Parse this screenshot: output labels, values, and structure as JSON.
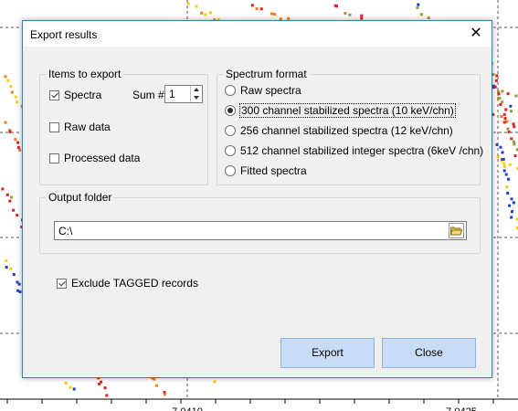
{
  "dialog": {
    "title": "Export results",
    "items_group": {
      "legend": "Items to export",
      "spectra": {
        "label": "Spectra",
        "checked": true
      },
      "sum": {
        "label": "Sum #",
        "value": "1"
      },
      "raw_data": {
        "label": "Raw data",
        "checked": false
      },
      "processed_data": {
        "label": "Processed data",
        "checked": false
      }
    },
    "format_group": {
      "legend": "Spectrum format",
      "options": [
        {
          "label": "Raw spectra",
          "selected": false
        },
        {
          "label": "300 channel stabilized spectra (10 keV/chn)",
          "selected": true
        },
        {
          "label": "256 channel stabilized spectra (12 keV/chn)",
          "selected": false
        },
        {
          "label": "512 channel stabilized integer spectra (6keV /chn)",
          "selected": false
        },
        {
          "label": "Fitted spectra",
          "selected": false
        }
      ]
    },
    "output_group": {
      "legend": "Output folder",
      "path": "C:\\"
    },
    "exclude_tagged": {
      "label": "Exclude TAGGED records",
      "checked": true
    },
    "export_button": "Export",
    "close_button": "Close"
  },
  "background": {
    "x_tick_labels": [
      "7.0410",
      "7.0425"
    ],
    "series_colors": [
      "#ffcc00",
      "#e8821e",
      "#e02020",
      "#9a9a3a",
      "#1f3fd0"
    ]
  }
}
